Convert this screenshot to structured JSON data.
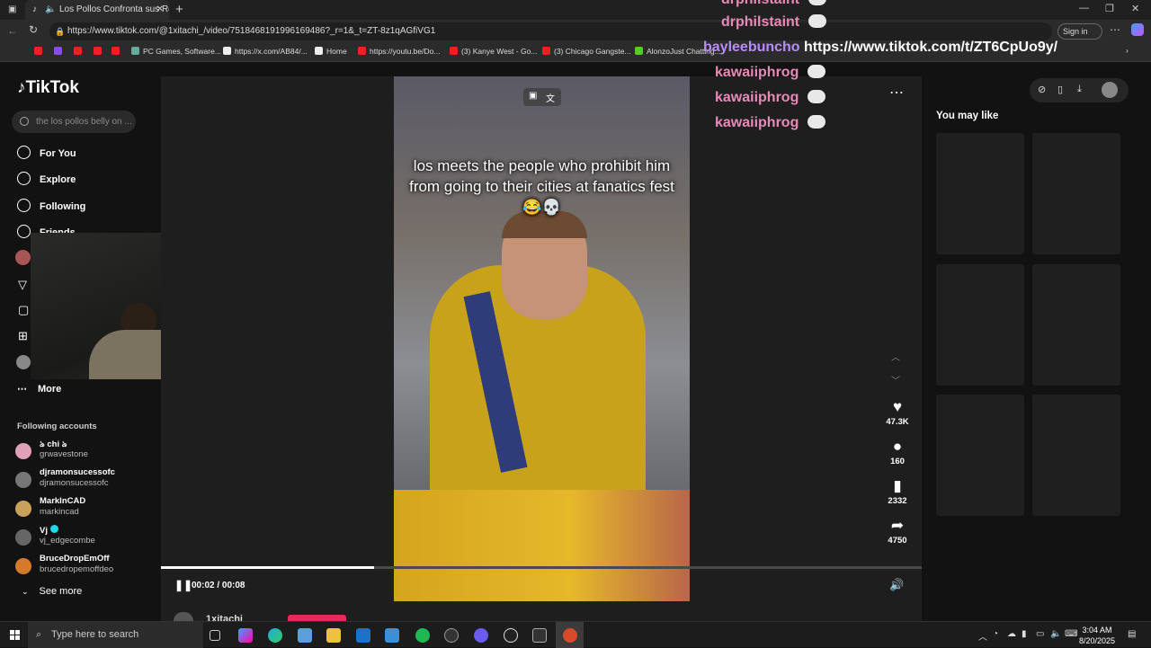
{
  "browser": {
    "tab_title": "Los Pollos Confronta sus Re",
    "url": "https://www.tiktok.com/@1xitachi_/video/7518468191996169486?_r=1&_t=ZT-8z1qAGfiVG1",
    "signin_label": "Sign in",
    "bookmarks": [
      "PC Games, Software...",
      "https://x.com/AB84/...",
      "Home",
      "https://youtu.be/Do...",
      "(3) Kanye West - Go...",
      "(3) Chicago Gangste...",
      "AlonzoJust Chatting..."
    ]
  },
  "sidebar": {
    "logo": "TikTok",
    "search_placeholder": "the los pollos belly on ...",
    "nav": [
      {
        "label": "For You"
      },
      {
        "label": "Explore"
      },
      {
        "label": "Following"
      },
      {
        "label": "Friends"
      }
    ],
    "more_label": "More",
    "following_title": "Following accounts",
    "accounts": [
      {
        "display": "ঌ chi ঌ",
        "handle": "grwavestone",
        "color": "#e0a0b8"
      },
      {
        "display": "djramonsucessofc",
        "handle": "djramonsucessofc",
        "color": "#777"
      },
      {
        "display": "MarkInCAD",
        "handle": "markincad",
        "color": "#c9a15a"
      },
      {
        "display": "Vj",
        "handle": "vj_edgecombe",
        "color": "#666"
      },
      {
        "display": "BruceDropEmOff",
        "handle": "brucedropemoffdeo",
        "color": "#d47a2a"
      }
    ],
    "see_more_label": "See more"
  },
  "player": {
    "caption": "los meets the people who prohibit him from going to their cities at fanatics fest 😂💀",
    "likes": "47.3K",
    "comments": "160",
    "saves": "2332",
    "shares": "4750",
    "time": "00:02 / 00:08",
    "progress": 0.28,
    "author": "1xitachi"
  },
  "right_panel": {
    "you_may_like": "You may like"
  },
  "chat": [
    {
      "user": "drphilstaint",
      "text": ""
    },
    {
      "user": "drphilstaint",
      "text": ""
    },
    {
      "user": "bayleebuncho",
      "text": "https://www.tiktok.com/t/ZT6CpUo9y/"
    },
    {
      "user": "kawaiiphrog",
      "text": ""
    },
    {
      "user": "kawaiiphrog",
      "text": ""
    },
    {
      "user": "kawaiiphrog",
      "text": ""
    }
  ],
  "taskbar": {
    "search_placeholder": "Type here to search",
    "time": "3:04 AM",
    "date": "8/20/2025"
  }
}
